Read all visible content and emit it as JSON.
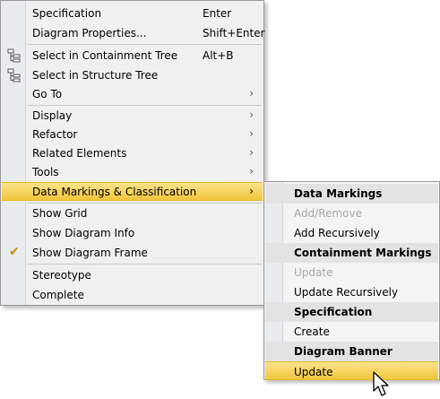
{
  "main_menu": {
    "items": [
      {
        "label": "Specification",
        "shortcut": "Enter"
      },
      {
        "label": "Diagram Properties...",
        "shortcut": "Shift+Enter"
      },
      {
        "label": "Select in Containment Tree",
        "shortcut": "Alt+B",
        "icon": "containment-tree-icon"
      },
      {
        "label": "Select in Structure Tree",
        "icon": "structure-tree-icon"
      },
      {
        "label": "Go To",
        "submenu": "›"
      },
      {
        "label": "Display",
        "submenu": "›"
      },
      {
        "label": "Refactor",
        "submenu": "›"
      },
      {
        "label": "Related Elements",
        "submenu": "›"
      },
      {
        "label": "Tools",
        "submenu": "›"
      },
      {
        "label": "Data Markings & Classification",
        "submenu": "›",
        "highlighted": true
      },
      {
        "label": "Show Grid"
      },
      {
        "label": "Show Diagram Info"
      },
      {
        "label": "Show Diagram Frame",
        "checked": true,
        "check_glyph": "✔"
      },
      {
        "label": "Stereotype"
      },
      {
        "label": "Complete"
      }
    ]
  },
  "sub_menu": {
    "items": [
      {
        "label": "Data Markings",
        "type": "header"
      },
      {
        "label": "Add/Remove",
        "type": "disabled"
      },
      {
        "label": "Add Recursively",
        "type": "normal"
      },
      {
        "label": "Containment Markings",
        "type": "header"
      },
      {
        "label": "Update",
        "type": "disabled"
      },
      {
        "label": "Update Recursively",
        "type": "normal"
      },
      {
        "label": "Specification",
        "type": "header"
      },
      {
        "label": "Create",
        "type": "normal"
      },
      {
        "label": "Diagram Banner",
        "type": "header"
      },
      {
        "label": "Update",
        "type": "highlight"
      }
    ]
  },
  "colors": {
    "highlight": "#f2c53d",
    "header_bg": "#e3e3e3",
    "disabled_text": "#a8a8a8",
    "check": "#d08a00"
  }
}
